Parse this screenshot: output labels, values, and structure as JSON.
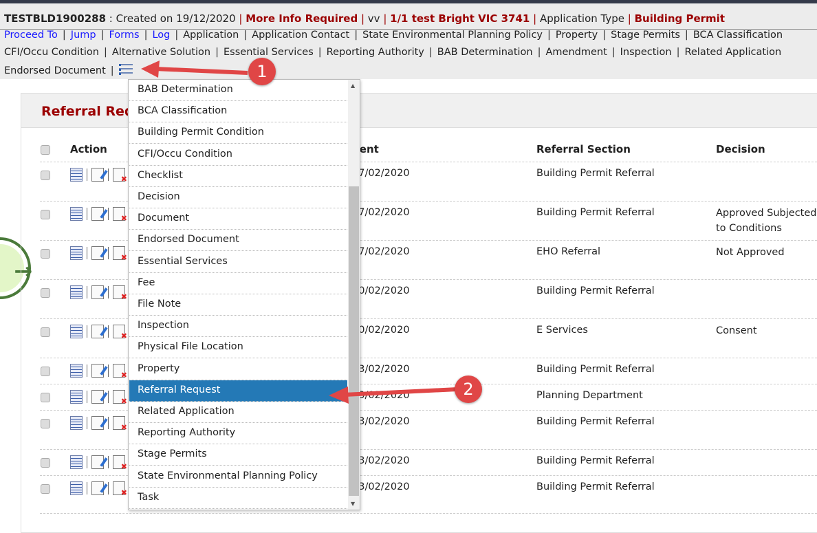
{
  "header": {
    "app_id": "TESTBLD1900288",
    "created": " : Created on 19/12/2020 ",
    "status": "More Info Required",
    "user": "vv",
    "address": "1/1 test Bright VIC 3741",
    "type_label": "Application Type",
    "type_value": "Building Permit"
  },
  "nav": {
    "row1": [
      {
        "label": "Proceed To",
        "link": true
      },
      {
        "label": "Jump",
        "link": true
      },
      {
        "label": "Forms",
        "link": true
      },
      {
        "label": "Log",
        "link": true
      },
      {
        "label": "Application"
      },
      {
        "label": "Application Contact"
      },
      {
        "label": "State Environmental Planning Policy"
      },
      {
        "label": "Property"
      },
      {
        "label": "Stage Permits"
      },
      {
        "label": "BCA Classification"
      }
    ],
    "row2": [
      "CFI/Occu Condition",
      "Alternative Solution",
      "Essential Services",
      "Reporting Authority",
      "BAB Determination",
      "Amendment",
      "Inspection",
      "Related Application"
    ],
    "row3": [
      "Endorsed Document"
    ],
    "menu_icon": "list-icon"
  },
  "panel": {
    "title": "Referral Request"
  },
  "table": {
    "headers": {
      "action": "Action",
      "sent": "Sent",
      "section": "Referral Section",
      "decision": "Decision"
    },
    "rows": [
      {
        "sent": "07/02/2020",
        "section": "Building Permit Referral",
        "decision": ""
      },
      {
        "sent": "07/02/2020",
        "section": "Building Permit Referral",
        "decision": "Approved Subjected to Conditions"
      },
      {
        "sent": "07/02/2020",
        "section": "EHO Referral",
        "decision": "Not Approved"
      },
      {
        "sent": "10/02/2020",
        "section": "Building Permit Referral",
        "decision": ""
      },
      {
        "sent": "10/02/2020",
        "section": "E Services",
        "decision": "Consent"
      },
      {
        "sent": "13/02/2020",
        "section": "Building Permit Referral",
        "decision": ""
      },
      {
        "sent": "13/02/2020",
        "section": "Planning Department",
        "decision": ""
      },
      {
        "sent": "13/02/2020",
        "section": "Building Permit Referral",
        "decision": ""
      },
      {
        "sent": "13/02/2020",
        "section": "Building Permit Referral",
        "decision": ""
      },
      {
        "sent": "13/02/2020",
        "section": "Building Permit Referral",
        "decision": ""
      }
    ]
  },
  "dropdown": {
    "items": [
      "BAB Determination",
      "BCA Classification",
      "Building Permit Condition",
      "CFI/Occu Condition",
      "Checklist",
      "Decision",
      "Document",
      "Endorsed Document",
      "Essential Services",
      "Fee",
      "File Note",
      "Inspection",
      "Physical File Location",
      "Property",
      "Referral Request",
      "Related Application",
      "Reporting Authority",
      "Stage Permits",
      "State Environmental Planning Policy",
      "Task"
    ],
    "selected": "Referral Request"
  },
  "annotations": {
    "one": "1",
    "two": "2"
  },
  "colors": {
    "accent": "#9b0000",
    "link": "#1a1aff",
    "selected": "#2479b6",
    "callout": "#e04646"
  }
}
